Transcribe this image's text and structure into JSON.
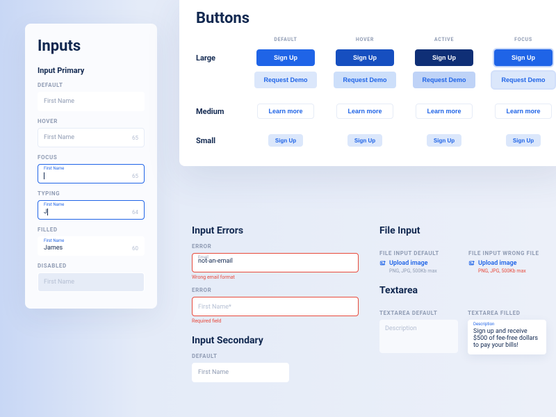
{
  "inputs": {
    "title": "Inputs",
    "primary_heading": "Input Primary",
    "states": {
      "default": "DEFAULT",
      "hover": "HOVER",
      "focus": "FOCUS",
      "typing": "TYPING",
      "filled": "FILLED",
      "disabled": "DISABLED"
    },
    "placeholder": "First Name",
    "typing_value": "J",
    "filled_value": "James",
    "counters": {
      "hover": "65",
      "focus": "65",
      "typing": "64",
      "filled": "60"
    }
  },
  "buttons": {
    "title": "Buttons",
    "columns": [
      "DEFAULT",
      "HOVER",
      "ACTIVE",
      "FOCUS"
    ],
    "rows": {
      "large": "Large",
      "medium": "Medium",
      "small": "Small"
    },
    "labels": {
      "signup": "Sign Up",
      "request_demo": "Request Demo",
      "learn_more": "Learn more"
    }
  },
  "errors": {
    "title": "Input Errors",
    "state_label": "ERROR",
    "email_label": "Email",
    "email_value": "not-an-email",
    "email_msg": "Wrong email format",
    "firstname_placeholder": "First Name*",
    "firstname_msg": "Required field"
  },
  "input_secondary": {
    "title": "Input Secondary",
    "state_label": "DEFAULT",
    "placeholder": "First Name"
  },
  "file": {
    "title": "File Input",
    "default_label": "FILE INPUT DEFAULT",
    "wrong_label": "FILE INPUT WRONG FILE",
    "link": "Upload image",
    "hint": "PNG, JPG, 500Kb max"
  },
  "textarea": {
    "title": "Textarea",
    "default_label": "TEXTAREA DEFAULT",
    "filled_label": "TEXTAREA FILLED",
    "placeholder": "Description",
    "floating": "Description",
    "value": "Sign up and receive $500 of fee-free dollars to pay your bills!"
  }
}
